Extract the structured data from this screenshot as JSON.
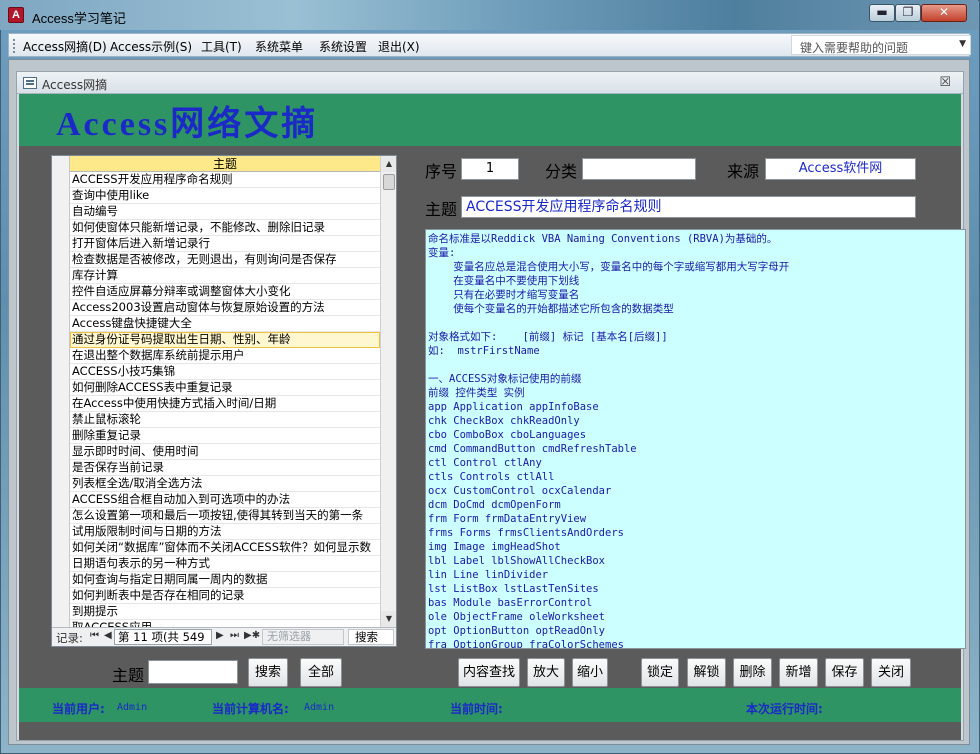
{
  "window": {
    "icon_letter": "A",
    "title": "Access学习笔记",
    "min_glyph": "▬",
    "max_glyph": "❐",
    "close_glyph": "✕"
  },
  "menubar": {
    "items": [
      "Access网摘(D)",
      "Access示例(S)",
      "工具(T)",
      "系统菜单",
      "系统设置",
      "退出(X)"
    ],
    "help_placeholder": "键入需要帮助的问题",
    "help_caret": "▼"
  },
  "child_window": {
    "title": "Access网摘",
    "close_glyph": "☒"
  },
  "header": {
    "title": "Access网络文摘"
  },
  "list": {
    "column_header": "主题",
    "rows": [
      "ACCESS开发应用程序命名规则",
      "查询中使用like",
      "自动编号",
      "如何使窗体只能新增记录，不能修改、删除旧记录",
      "打开窗体后进入新增记录行",
      "检查数据是否被修改，无则退出，有则询问是否保存",
      "库存计算",
      "控件自适应屏幕分辩率或调整窗体大小变化",
      "Access2003设置启动窗体与恢复原始设置的方法",
      "Access键盘快捷键大全",
      "通过身份证号码提取出生日期、性别、年龄",
      "在退出整个数据库系统前提示用户",
      "ACCESS小技巧集锦",
      "如何删除ACCESS表中重复记录",
      "在Access中使用快捷方式插入时间/日期",
      "禁止鼠标滚轮",
      "删除重复记录",
      "显示即时时间、使用时间",
      "是否保存当前记录",
      "列表框全选/取消全选方法",
      "ACCESS组合框自动加入到可选项中的办法",
      "怎么设置第一项和最后一项按钮,使得其转到当天的第一条",
      "试用版限制时间与日期的方法",
      "如何关闭“数据库”窗体而不关闭ACCESS软件？如何显示数",
      "日期语句表示的另一种方式",
      "如何查询与指定日期同属一周内的数据",
      "如何判断表中是否存在相同的记录",
      "到期提示",
      "取ACCESS应用..."
    ],
    "selected_index": 10,
    "nav": {
      "label": "记录:",
      "first": "⏮",
      "prev": "◀",
      "position": "第 11 项(共 549",
      "next": "▶",
      "last": "⏭",
      "new": "▶✱",
      "filter": "无筛选器",
      "search": "搜索"
    }
  },
  "fields": {
    "seq_label": "序号",
    "seq_value": "1",
    "category_label": "分类",
    "category_value": "",
    "source_label": "来源",
    "source_value": "Access软件网",
    "topic_label": "主题",
    "topic_value": "ACCESS开发应用程序命名规则"
  },
  "content_lines": [
    "命名标准是以Reddick VBA Naming Conventions (RBVA)为基础的。",
    "变量:",
    "    变量名应总是混合使用大小写，变量名中的每个字或缩写都用大写字母开",
    "    在变量名中不要使用下划线",
    "    只有在必要时才缩写变量名",
    "    使每个变量名的开始都描述它所包含的数据类型",
    "",
    "对象格式如下:    [前缀] 标记 [基本名[后缀]]",
    "如:  mstrFirstName",
    "",
    "一、ACCESS对象标记使用的前缀",
    "前缀 控件类型 实例",
    "app Application appInfoBase",
    "chk CheckBox chkReadOnly",
    "cbo ComboBox cboLanguages",
    "cmd CommandButton cmdRefreshTable",
    "ctl Control ctlAny",
    "ctls Controls ctlAll",
    "ocx CustomControl ocxCalendar",
    "dcm DoCmd dcmOpenForm",
    "frm Form frmDataEntryView",
    "frms Forms frmsClientsAndOrders",
    "img Image imgHeadShot",
    "lbl Label lblShowAllCheckBox",
    "lin Line linDivider",
    "lst ListBox lstLastTenSites",
    "bas Module basErrorControl",
    "ole ObjectFrame oleWorksheet",
    "opt OptionButton optReadOnly",
    "fra OptionGroup fraColorSchemes"
  ],
  "search": {
    "label": "主题",
    "value": "",
    "search_button": "搜索",
    "all_button": "全部"
  },
  "actions": {
    "find_content": "内容查找",
    "zoom_in": "放大",
    "zoom_out": "缩小",
    "lock": "锁定",
    "unlock": "解锁",
    "delete": "删除",
    "add": "新增",
    "save": "保存",
    "close": "关闭"
  },
  "footer": {
    "user_label": "当前用户:",
    "user_value": "Admin",
    "computer_label": "当前计算机名:",
    "computer_value": "Admin",
    "time_label": "当前时间:",
    "time_value": "",
    "runtime_label": "本次运行时间:",
    "runtime_value": ""
  },
  "colors": {
    "green": "#2e9463",
    "blue_text": "#1a29c7",
    "memo_bg": "#ccffff",
    "list_header": "#fde98a"
  }
}
